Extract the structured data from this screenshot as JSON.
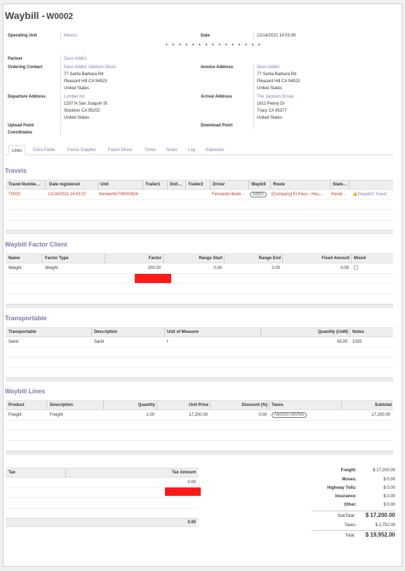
{
  "header": {
    "title": "Waybill -",
    "number": "W0002"
  },
  "fields": {
    "operating_unit_label": "Operating Unit",
    "operating_unit": "Mexico",
    "date_label": "Date",
    "date": "12/14/2021 14:03:39",
    "partner_label": "Partner",
    "partner": "Deco Addict",
    "ordering_contact_label": "Ordering Contact",
    "ordering_contact_name": "Deco Addict, Addison Olson",
    "ordering_contact_lines": [
      "77 Santa Barbara Rd",
      "Pleasant Hill CA 94523",
      "United States"
    ],
    "invoice_address_label": "Invoice Address",
    "invoice_address_name": "Deco Addict",
    "invoice_address_lines": [
      "77 Santa Barbara Rd",
      "Pleasant Hill CA 94523",
      "United States"
    ],
    "departure_address_label": "Departure Address",
    "departure_address_name": "Lumber Inc",
    "departure_address_lines": [
      "1337 N San Joaquin St",
      "Stockton CA 95202",
      "United States"
    ],
    "arrival_address_label": "Arrival Address",
    "arrival_address_name": "The Jackson Group",
    "arrival_address_lines": [
      "1611 Peony Dr",
      "Tracy CA 95377",
      "United States"
    ],
    "upload_point_label_1": "Upload Point",
    "upload_point_label_2": "Coordinates",
    "download_point_label": "Download Point"
  },
  "statusbar_dots": "• • • • • • • • • • • • • • •",
  "tabs": [
    "Lines",
    "Extra Fields",
    "Factor Supplier",
    "Factor Driver",
    "Times",
    "Notes",
    "Log",
    "Expenses"
  ],
  "travels": {
    "title": "Travels",
    "headers": [
      "Travel Numbe…",
      "Date registered",
      "Unit",
      "Trailer1",
      "Dolly…",
      "Trailer2",
      "Driver",
      "Waybill",
      "Route",
      "State…"
    ],
    "row": {
      "number": "T0002",
      "date": "12/14/2021 14:03:37",
      "unit": "Kenworth/T800/0924",
      "driver": "Fernando Bedo…",
      "waybill": "W0002",
      "route": "[Company] El Paso - Hou…",
      "state": "Pendi…",
      "action": "Dispatch Travel"
    }
  },
  "factor_client": {
    "title": "Waybill Factor Client",
    "headers": [
      "Name",
      "Factor Type",
      "Factor",
      "Range Start",
      "Range End",
      "Fixed Amount",
      "Mixed"
    ],
    "row": {
      "name": "Weight",
      "type": "Weight",
      "factor": "200.00",
      "start": "0.00",
      "end": "0.00",
      "fixed": "0.00"
    }
  },
  "transportable": {
    "title": "Transportable",
    "headers": [
      "Transportable",
      "Description",
      "Unit of Measure",
      "Quantity (UoM)",
      "Notes"
    ],
    "row": {
      "name": "Sand",
      "description": "Sand",
      "uom": "t",
      "qty": "43.00",
      "notes": "1025"
    }
  },
  "waybill_lines": {
    "title": "Waybill Lines",
    "headers": [
      "Product",
      "Description",
      "Quantity",
      "Unit Price",
      "Discount (%)",
      "Taxes",
      "Subtotal"
    ],
    "row": {
      "product": "Freight",
      "description": "Freight",
      "qty": "1.00",
      "price": "17,200.00",
      "discount": "0.00",
      "tax": "IVA(16%) VENTAS",
      "subtotal": "17,200.00"
    }
  },
  "tax_table": {
    "headers": [
      "Tax",
      "Tax Amount"
    ],
    "amount": "0.00",
    "footer": "0.00"
  },
  "totals": {
    "freight_label": "Freight:",
    "freight": "$ 17,200.00",
    "moves_label": "Moves:",
    "moves": "$ 0.00",
    "tolls_label": "Highway Tolls:",
    "tolls": "$ 0.00",
    "insurance_label": "Insurance:",
    "insurance": "$ 0.00",
    "other_label": "Other:",
    "other": "$ 0.00",
    "subtotal_label": "SubTotal:",
    "subtotal": "$ 17,200.00",
    "taxes_label": "Taxes:",
    "taxes": "$ 2,752.00",
    "total_label": "Total:",
    "total": "$ 19,952.00"
  },
  "colors": {
    "link": "#7c7bad",
    "accent_red": "#ff1a1a",
    "status_red": "#b03a2e"
  }
}
